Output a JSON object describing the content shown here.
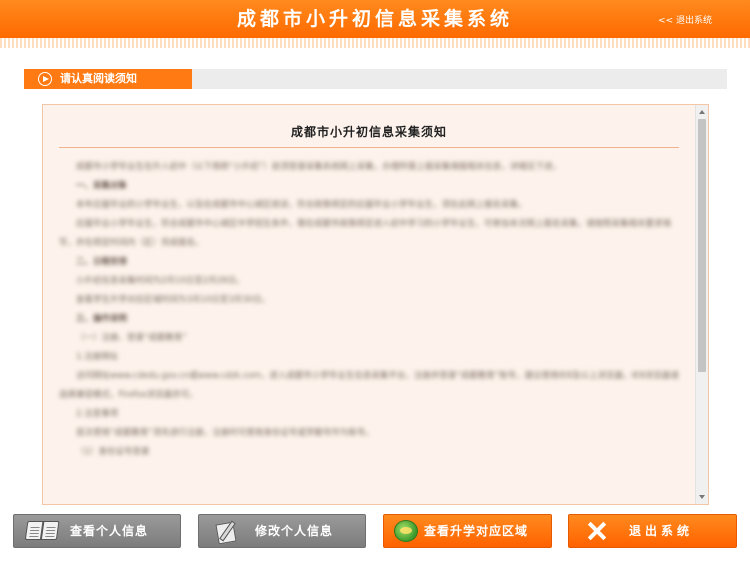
{
  "header": {
    "title": "成都市小升初信息采集系统",
    "logout_label": "<< 退出系统"
  },
  "section": {
    "tab_label": "请认真阅读须知"
  },
  "notice": {
    "title": "成都市小升初信息采集须知",
    "paragraphs": [
      "成都市小学毕业生在升入初中（以下简称“小升初”）前须登录采集系统网上采集，办理所需上报采集填报相关信息，详细见下述。",
      "一、采集对象",
      "本年应届毕业的小学毕业生，以及在成都市中心城区就读，符合政策规定的应届毕业小学毕业生，须在此网上报名采集。",
      "应届毕业小学毕业生，符合成都市中心城区中学招生条件，需在成都市政策规定进入初中学习的小学毕业生，可参加本次网上报名采集，请按照采集相关要求填写，并在规定时间内（区）完成报名。",
      "二、日程安排",
      "小升初信息采集时间为2月10日至2月28日。",
      "查看学生升学对应区域时间为3月10日至3月30日。",
      "三、操作说明",
      "（一）注册、登录“成都教育”",
      "1.注册网址",
      "访问网址www.cdedu.gov.cn或www.cdzk.com，进入成都市小学毕业生信息采集平台，注册并登录“成都教育”账号，建议使用IE8及以上浏览器，IE8浏览器请选择兼容模式，Firefox浏览器亦可。",
      "2.注意事项",
      "首次使用“成都教育”须先进行注册，注册时可使用身份证号或学籍号作为账号。",
      "（1）身份证号登录"
    ]
  },
  "buttons": {
    "view_info": "查看个人信息",
    "edit_info": "修改个人信息",
    "view_area": "查看升学对应区域",
    "exit": "退出系统"
  },
  "colors": {
    "accent": "#ff6a00",
    "button_gray": "#8a8a8a",
    "notice_bg": "#fdf3ec"
  }
}
